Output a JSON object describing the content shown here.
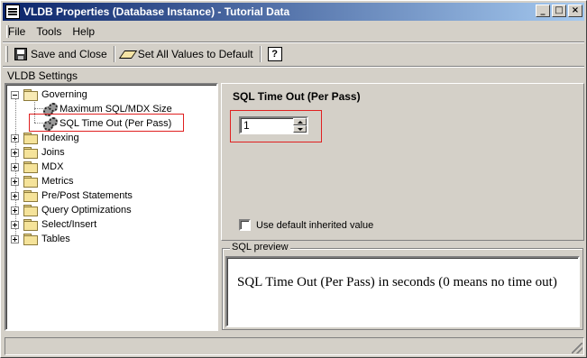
{
  "window": {
    "title": "VLDB Properties (Database Instance) - Tutorial Data",
    "controls": {
      "minimize": "_",
      "maximize": "□",
      "close": "×"
    }
  },
  "menu": {
    "file": "File",
    "tools": "Tools",
    "help": "Help"
  },
  "toolbar": {
    "save_close": "Save and Close",
    "set_defaults": "Set All Values to Default",
    "help_symbol": "?"
  },
  "section_label": "VLDB Settings",
  "tree": {
    "governing": "Governing",
    "max_sql_size": "Maximum SQL/MDX Size",
    "sql_timeout": "SQL Time Out (Per Pass)",
    "indexing": "Indexing",
    "joins": "Joins",
    "mdx": "MDX",
    "metrics": "Metrics",
    "pre_post": "Pre/Post Statements",
    "query_opt": "Query Optimizations",
    "select_insert": "Select/Insert",
    "tables": "Tables"
  },
  "property": {
    "title": "SQL Time Out (Per Pass)",
    "value": "1",
    "use_default_label": "Use default inherited value"
  },
  "preview": {
    "legend": "SQL preview",
    "text": "SQL Time Out (Per Pass) in seconds (0 means no time out)"
  },
  "colors": {
    "highlight": "#e02020",
    "title_bar": "#0a246a",
    "face": "#d4d0c8"
  }
}
